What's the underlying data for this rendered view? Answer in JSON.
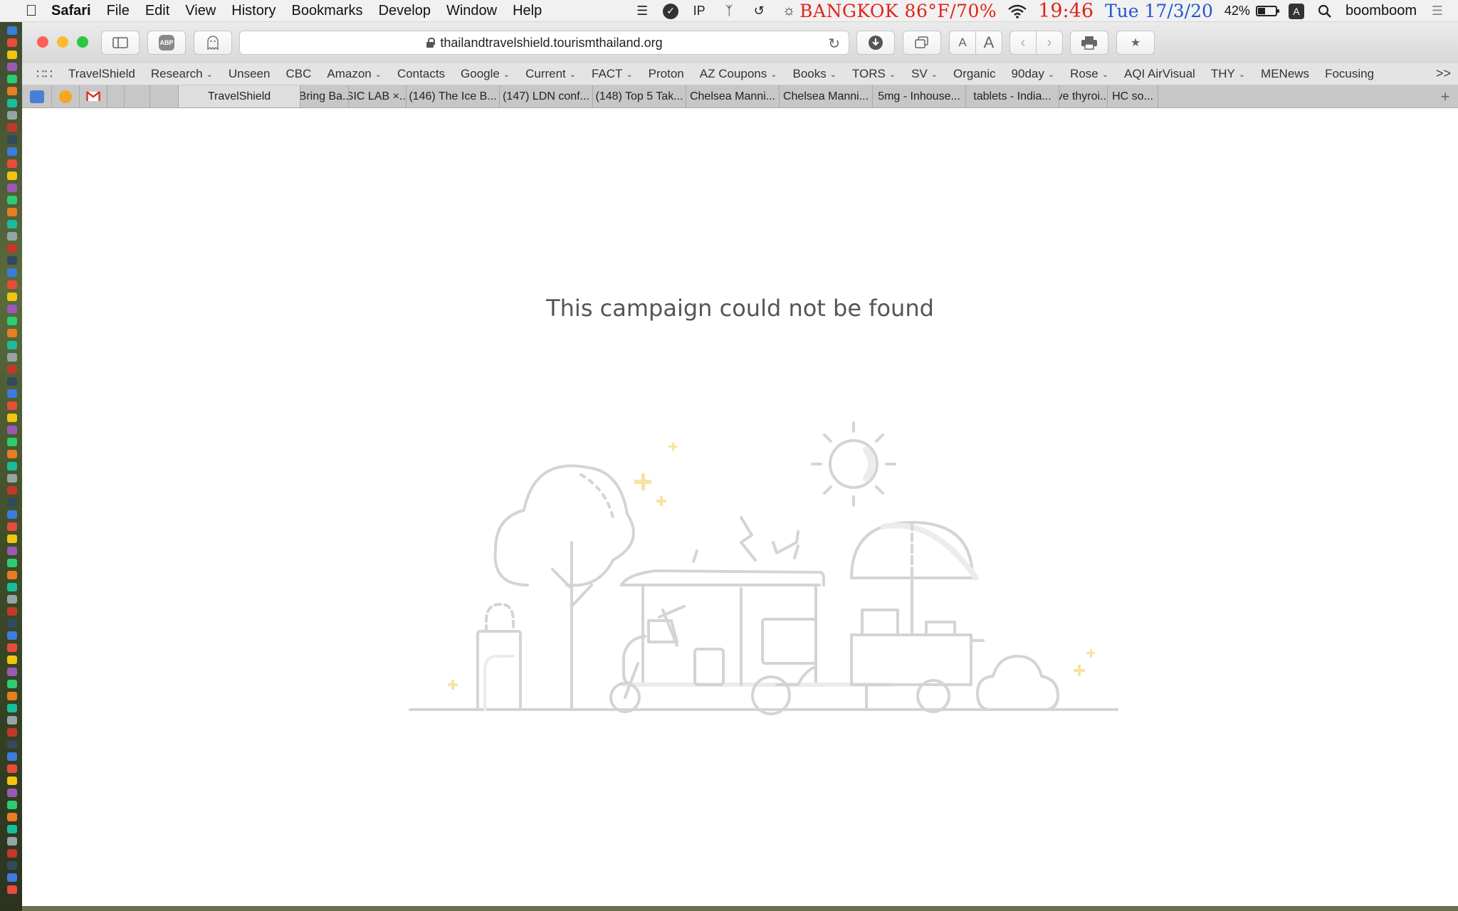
{
  "menubar": {
    "app_name": "Safari",
    "menus": [
      "File",
      "Edit",
      "View",
      "History",
      "Bookmarks",
      "Develop",
      "Window",
      "Help"
    ],
    "status": {
      "ip_label": "IP",
      "weather": "BANGKOK 86°F/70%",
      "time": "19:46",
      "date": "Tue 17/3/20",
      "battery_percent_label": "42%",
      "battery_level": 0.42,
      "input_label": "A",
      "username": "boomboom"
    }
  },
  "toolbar": {
    "url": "thailandtravelshield.tourismthailand.org",
    "abp_label": "ABP",
    "text_smaller_label": "A",
    "text_larger_label": "A"
  },
  "bookmarks": [
    {
      "label": "TravelShield",
      "folder": false
    },
    {
      "label": "Research",
      "folder": true
    },
    {
      "label": "Unseen",
      "folder": false
    },
    {
      "label": "CBC",
      "folder": false
    },
    {
      "label": "Amazon",
      "folder": true
    },
    {
      "label": "Contacts",
      "folder": false
    },
    {
      "label": "Google",
      "folder": true
    },
    {
      "label": "Current",
      "folder": true
    },
    {
      "label": "FACT",
      "folder": true
    },
    {
      "label": "Proton",
      "folder": false
    },
    {
      "label": "AZ Coupons",
      "folder": true
    },
    {
      "label": "Books",
      "folder": true
    },
    {
      "label": "TORS",
      "folder": true
    },
    {
      "label": "SV",
      "folder": true
    },
    {
      "label": "Organic",
      "folder": false
    },
    {
      "label": "90day",
      "folder": true
    },
    {
      "label": "Rose",
      "folder": true
    },
    {
      "label": "AQI AirVisual",
      "folder": false
    },
    {
      "label": "THY",
      "folder": true
    },
    {
      "label": "MENews",
      "folder": false
    },
    {
      "label": "Focusing",
      "folder": false
    }
  ],
  "bookmarks_more_label": ">>",
  "tabs": [
    {
      "label": "TravelShield",
      "active": true
    },
    {
      "label": "'Bring Ba...",
      "active": false
    },
    {
      "label": "SIC LAB ×...",
      "active": false
    },
    {
      "label": "(146) The Ice B...",
      "active": false
    },
    {
      "label": "(147) LDN conf...",
      "active": false
    },
    {
      "label": "(148) Top 5 Tak...",
      "active": false
    },
    {
      "label": "Chelsea Manni...",
      "active": false
    },
    {
      "label": "Chelsea Manni...",
      "active": false
    },
    {
      "label": "5mg - Inhouse...",
      "active": false
    },
    {
      "label": "tablets - India...",
      "active": false
    },
    {
      "label": "ve thyroi...",
      "active": false
    },
    {
      "label": "HC so...",
      "active": false
    }
  ],
  "page": {
    "message": "This campaign could not be found"
  },
  "colors": {
    "weather": "#e0231a",
    "time": "#e0231a",
    "date": "#2257c8",
    "close": "#fc5f57",
    "minimize": "#fdbc2e",
    "zoom": "#28c840",
    "illustration_line": "#d4d4d4",
    "sparkle": "#f7e3a1"
  }
}
